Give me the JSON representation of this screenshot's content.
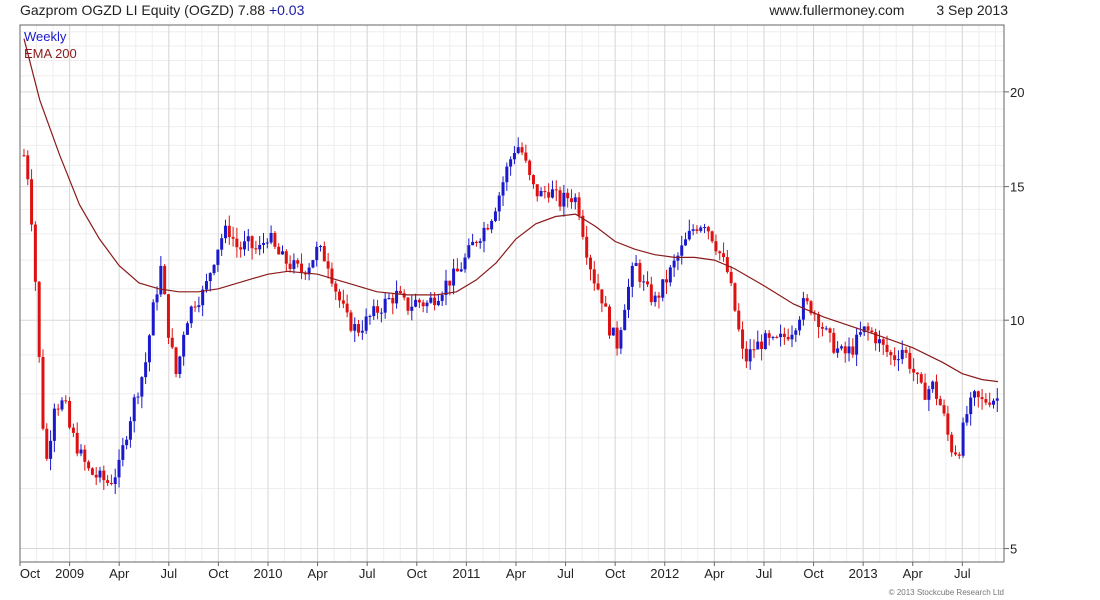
{
  "header": {
    "title": "Gazprom OGZD LI Equity (OGZD) 7.88",
    "change": "+0.03",
    "site": "www.fullermoney.com",
    "date": "3 Sep 2013"
  },
  "copyright": "© 2013 Stockcube Research Ltd",
  "colors": {
    "up": "#1a1acc",
    "down": "#dd1111",
    "ema": "#8b1a1a",
    "grid": "#d8d8d8",
    "border": "#666666"
  },
  "chart_data": {
    "type": "candlestick",
    "title": "Gazprom OGZD LI Equity (OGZD) 7.88",
    "frequency": "Weekly",
    "y_scale": "log",
    "ylim": [
      4.8,
      24.5
    ],
    "xlim": [
      2008.75,
      2013.71
    ],
    "yticks": [
      5,
      10,
      15,
      20
    ],
    "xticks": [
      {
        "x": 2008.75,
        "label": "Oct"
      },
      {
        "x": 2009.0,
        "label": "2009"
      },
      {
        "x": 2009.25,
        "label": "Apr"
      },
      {
        "x": 2009.5,
        "label": "Jul"
      },
      {
        "x": 2009.75,
        "label": "Oct"
      },
      {
        "x": 2010.0,
        "label": "2010"
      },
      {
        "x": 2010.25,
        "label": "Apr"
      },
      {
        "x": 2010.5,
        "label": "Jul"
      },
      {
        "x": 2010.75,
        "label": "Oct"
      },
      {
        "x": 2011.0,
        "label": "2011"
      },
      {
        "x": 2011.25,
        "label": "Apr"
      },
      {
        "x": 2011.5,
        "label": "Jul"
      },
      {
        "x": 2011.75,
        "label": "Oct"
      },
      {
        "x": 2012.0,
        "label": "2012"
      },
      {
        "x": 2012.25,
        "label": "Apr"
      },
      {
        "x": 2012.5,
        "label": "Jul"
      },
      {
        "x": 2012.75,
        "label": "Oct"
      },
      {
        "x": 2013.0,
        "label": "2013"
      },
      {
        "x": 2013.25,
        "label": "Apr"
      },
      {
        "x": 2013.5,
        "label": "Jul"
      }
    ],
    "grid": true,
    "legend": [
      {
        "name": "Weekly",
        "color": "#1a1acc"
      },
      {
        "name": "EMA 200",
        "color": "#8b1a1a"
      }
    ],
    "legend_position": "top-left",
    "close_series": [
      [
        2008.77,
        16.5
      ],
      [
        2008.79,
        15.5
      ],
      [
        2008.81,
        13.5
      ],
      [
        2008.83,
        11.0
      ],
      [
        2008.85,
        8.5
      ],
      [
        2008.87,
        7.0
      ],
      [
        2008.89,
        6.4
      ],
      [
        2008.91,
        7.4
      ],
      [
        2008.93,
        8.0
      ],
      [
        2008.95,
        7.6
      ],
      [
        2008.97,
        7.9
      ],
      [
        2009.0,
        7.2
      ],
      [
        2009.03,
        6.9
      ],
      [
        2009.06,
        6.6
      ],
      [
        2009.1,
        6.3
      ],
      [
        2009.15,
        6.2
      ],
      [
        2009.2,
        6.1
      ],
      [
        2009.25,
        6.4
      ],
      [
        2009.28,
        7.0
      ],
      [
        2009.33,
        7.9
      ],
      [
        2009.38,
        8.7
      ],
      [
        2009.42,
        10.3
      ],
      [
        2009.46,
        11.7
      ],
      [
        2009.5,
        9.6
      ],
      [
        2009.54,
        8.4
      ],
      [
        2009.58,
        9.9
      ],
      [
        2009.63,
        10.6
      ],
      [
        2009.68,
        10.9
      ],
      [
        2009.72,
        11.9
      ],
      [
        2009.76,
        12.8
      ],
      [
        2009.8,
        13.2
      ],
      [
        2009.85,
        12.4
      ],
      [
        2009.9,
        12.6
      ],
      [
        2009.95,
        12.3
      ],
      [
        2010.0,
        13.0
      ],
      [
        2010.04,
        12.3
      ],
      [
        2010.08,
        12.0
      ],
      [
        2010.12,
        11.8
      ],
      [
        2010.17,
        11.6
      ],
      [
        2010.21,
        11.9
      ],
      [
        2010.25,
        12.4
      ],
      [
        2010.3,
        12.0
      ],
      [
        2010.35,
        10.8
      ],
      [
        2010.4,
        10.0
      ],
      [
        2010.45,
        9.7
      ],
      [
        2010.5,
        10.0
      ],
      [
        2010.55,
        10.3
      ],
      [
        2010.6,
        10.6
      ],
      [
        2010.65,
        10.8
      ],
      [
        2010.7,
        10.4
      ],
      [
        2010.75,
        10.6
      ],
      [
        2010.8,
        10.5
      ],
      [
        2010.85,
        10.8
      ],
      [
        2010.9,
        11.2
      ],
      [
        2010.95,
        11.5
      ],
      [
        2011.0,
        12.1
      ],
      [
        2011.04,
        12.7
      ],
      [
        2011.08,
        13.1
      ],
      [
        2011.12,
        13.6
      ],
      [
        2011.16,
        14.5
      ],
      [
        2011.2,
        15.7
      ],
      [
        2011.24,
        16.8
      ],
      [
        2011.27,
        17.0
      ],
      [
        2011.3,
        16.0
      ],
      [
        2011.33,
        15.0
      ],
      [
        2011.37,
        14.6
      ],
      [
        2011.42,
        14.9
      ],
      [
        2011.47,
        14.3
      ],
      [
        2011.52,
        14.6
      ],
      [
        2011.56,
        14.4
      ],
      [
        2011.6,
        12.6
      ],
      [
        2011.64,
        11.4
      ],
      [
        2011.68,
        10.8
      ],
      [
        2011.72,
        9.8
      ],
      [
        2011.76,
        9.3
      ],
      [
        2011.8,
        10.6
      ],
      [
        2011.85,
        11.9
      ],
      [
        2011.9,
        11.0
      ],
      [
        2011.95,
        10.6
      ],
      [
        2012.0,
        11.2
      ],
      [
        2012.05,
        11.9
      ],
      [
        2012.1,
        12.6
      ],
      [
        2012.15,
        13.3
      ],
      [
        2012.2,
        13.5
      ],
      [
        2012.24,
        12.9
      ],
      [
        2012.28,
        12.2
      ],
      [
        2012.32,
        11.5
      ],
      [
        2012.36,
        10.1
      ],
      [
        2012.4,
        8.8
      ],
      [
        2012.45,
        9.2
      ],
      [
        2012.5,
        9.4
      ],
      [
        2012.55,
        9.3
      ],
      [
        2012.6,
        9.5
      ],
      [
        2012.65,
        9.8
      ],
      [
        2012.7,
        10.5
      ],
      [
        2012.74,
        10.4
      ],
      [
        2012.78,
        10.0
      ],
      [
        2012.82,
        9.5
      ],
      [
        2012.86,
        9.2
      ],
      [
        2012.9,
        9.0
      ],
      [
        2012.95,
        9.2
      ],
      [
        2013.0,
        9.7
      ],
      [
        2013.05,
        9.6
      ],
      [
        2013.1,
        9.2
      ],
      [
        2013.15,
        8.9
      ],
      [
        2013.2,
        9.2
      ],
      [
        2013.25,
        8.6
      ],
      [
        2013.3,
        8.0
      ],
      [
        2013.35,
        8.2
      ],
      [
        2013.4,
        7.6
      ],
      [
        2013.44,
        6.8
      ],
      [
        2013.48,
        6.7
      ],
      [
        2013.52,
        7.5
      ],
      [
        2013.56,
        7.9
      ],
      [
        2013.6,
        7.8
      ],
      [
        2013.64,
        7.9
      ],
      [
        2013.68,
        7.88
      ]
    ],
    "ema200": [
      [
        2008.77,
        23.5
      ],
      [
        2008.85,
        19.5
      ],
      [
        2008.95,
        16.5
      ],
      [
        2009.05,
        14.2
      ],
      [
        2009.15,
        12.8
      ],
      [
        2009.25,
        11.8
      ],
      [
        2009.35,
        11.2
      ],
      [
        2009.45,
        11.0
      ],
      [
        2009.55,
        10.9
      ],
      [
        2009.65,
        10.9
      ],
      [
        2009.75,
        11.0
      ],
      [
        2009.9,
        11.3
      ],
      [
        2010.0,
        11.5
      ],
      [
        2010.1,
        11.6
      ],
      [
        2010.25,
        11.5
      ],
      [
        2010.4,
        11.2
      ],
      [
        2010.55,
        10.9
      ],
      [
        2010.7,
        10.8
      ],
      [
        2010.85,
        10.8
      ],
      [
        2010.95,
        10.9
      ],
      [
        2011.05,
        11.3
      ],
      [
        2011.15,
        11.9
      ],
      [
        2011.25,
        12.8
      ],
      [
        2011.35,
        13.4
      ],
      [
        2011.45,
        13.7
      ],
      [
        2011.55,
        13.8
      ],
      [
        2011.65,
        13.3
      ],
      [
        2011.75,
        12.7
      ],
      [
        2011.85,
        12.4
      ],
      [
        2011.95,
        12.2
      ],
      [
        2012.05,
        12.1
      ],
      [
        2012.15,
        12.1
      ],
      [
        2012.25,
        12.0
      ],
      [
        2012.35,
        11.7
      ],
      [
        2012.5,
        11.1
      ],
      [
        2012.65,
        10.5
      ],
      [
        2012.8,
        10.1
      ],
      [
        2012.95,
        9.8
      ],
      [
        2013.1,
        9.5
      ],
      [
        2013.25,
        9.2
      ],
      [
        2013.4,
        8.8
      ],
      [
        2013.5,
        8.5
      ],
      [
        2013.6,
        8.35
      ],
      [
        2013.68,
        8.3
      ]
    ]
  }
}
